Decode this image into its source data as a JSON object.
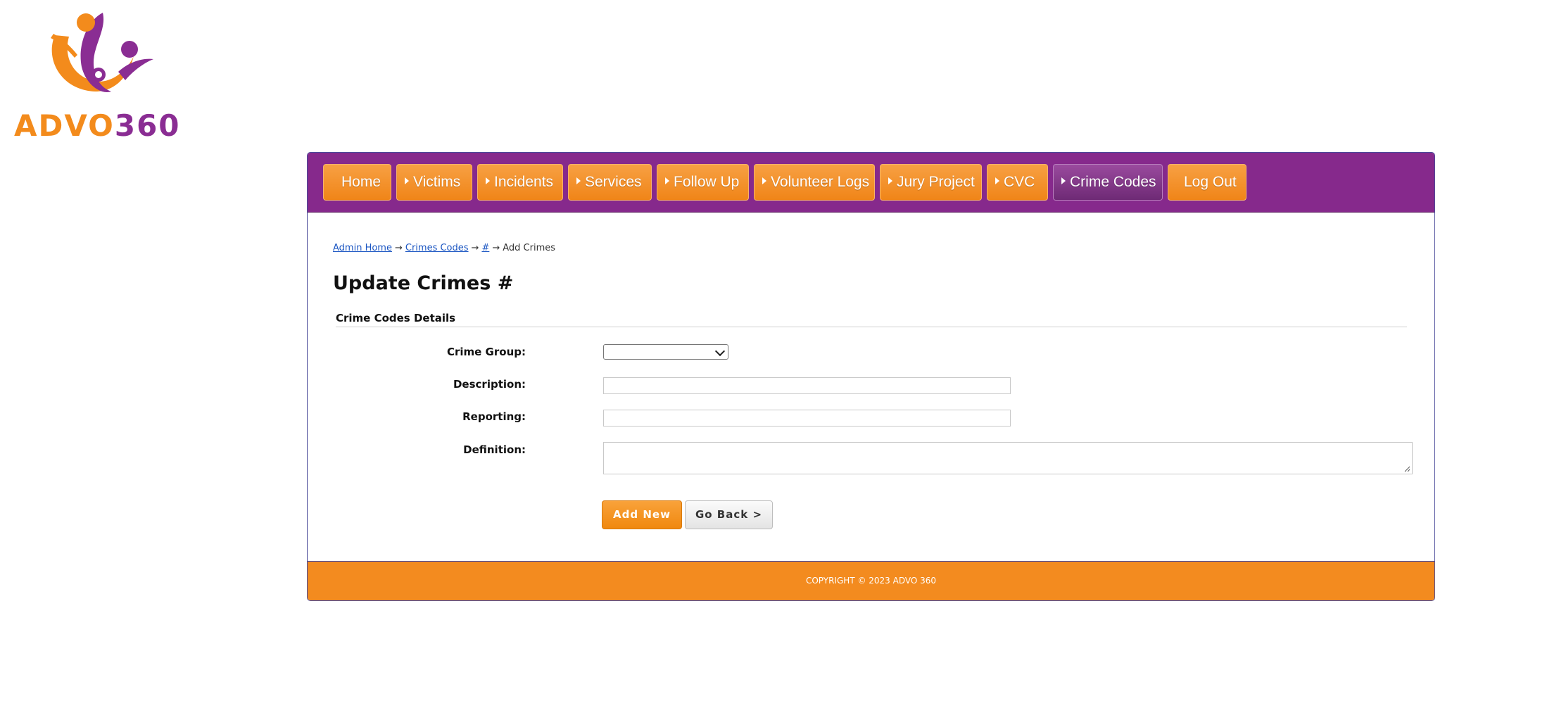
{
  "logo": {
    "text_part1": "ADVO",
    "text_part2": "360"
  },
  "nav": {
    "items": [
      {
        "label": "Home",
        "arrow": false,
        "active": false
      },
      {
        "label": "Victims",
        "arrow": true,
        "active": false
      },
      {
        "label": "Incidents",
        "arrow": true,
        "active": false
      },
      {
        "label": "Services",
        "arrow": true,
        "active": false
      },
      {
        "label": "Follow Up",
        "arrow": true,
        "active": false
      },
      {
        "label": "Volunteer Logs",
        "arrow": true,
        "active": false
      },
      {
        "label": "Jury Project",
        "arrow": true,
        "active": false
      },
      {
        "label": "CVC",
        "arrow": true,
        "active": false
      },
      {
        "label": "Crime Codes",
        "arrow": true,
        "active": true
      },
      {
        "label": "Log Out",
        "arrow": false,
        "active": false
      }
    ]
  },
  "breadcrumb": {
    "admin_home": "Admin Home",
    "crimes_codes": "Crimes Codes",
    "hash": "#",
    "current": "Add Crimes"
  },
  "page_title": "Update Crimes #",
  "section_title": "Crime Codes Details",
  "form": {
    "crime_group_label": "Crime Group:",
    "crime_group_value": "",
    "description_label": "Description:",
    "description_value": "",
    "reporting_label": "Reporting:",
    "reporting_value": "",
    "definition_label": "Definition:",
    "definition_value": ""
  },
  "buttons": {
    "add_new": "Add New",
    "go_back": "Go Back >"
  },
  "footer": {
    "text": "COPYRIGHT © 2023 ADVO 360"
  },
  "colors": {
    "nav_bg": "#86298c",
    "nav_button": "#f08518",
    "nav_active": "#6e2a75",
    "footer_bg": "#f38b1f",
    "link": "#1a55c2"
  }
}
